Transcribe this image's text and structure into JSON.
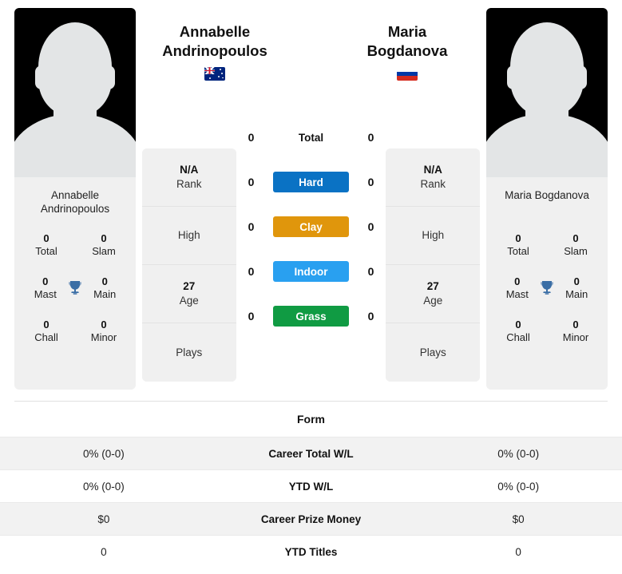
{
  "players": {
    "left": {
      "name_line1": "Annabelle",
      "name_line2": "Andrinopoulos",
      "full_name": "Annabelle Andrinopoulos",
      "flag": "au-flag-icon",
      "card_name_line1": "Annabelle",
      "card_name_line2": "Andrinopoulos",
      "titles": {
        "total_value": "0",
        "total_label": "Total",
        "slam_value": "0",
        "slam_label": "Slam",
        "mast_value": "0",
        "mast_label": "Mast",
        "main_value": "0",
        "main_label": "Main",
        "chall_value": "0",
        "chall_label": "Chall",
        "minor_value": "0",
        "minor_label": "Minor"
      },
      "info": {
        "rank_value": "N/A",
        "rank_label": "Rank",
        "high_value": "",
        "high_label": "High",
        "age_value": "27",
        "age_label": "Age",
        "plays_value": "",
        "plays_label": "Plays"
      },
      "surface_counts": {
        "total": "0",
        "hard": "0",
        "clay": "0",
        "indoor": "0",
        "grass": "0"
      },
      "form": {
        "career_wl": "0% (0-0)",
        "ytd_wl": "0% (0-0)",
        "career_prize_money": "$0",
        "ytd_titles": "0"
      }
    },
    "right": {
      "name_line1": "Maria",
      "name_line2": "Bogdanova",
      "full_name": "Maria Bogdanova",
      "flag": "ru-flag-icon",
      "card_name_line1": "Maria Bogdanova",
      "card_name_line2": "",
      "titles": {
        "total_value": "0",
        "total_label": "Total",
        "slam_value": "0",
        "slam_label": "Slam",
        "mast_value": "0",
        "mast_label": "Mast",
        "main_value": "0",
        "main_label": "Main",
        "chall_value": "0",
        "chall_label": "Chall",
        "minor_value": "0",
        "minor_label": "Minor"
      },
      "info": {
        "rank_value": "N/A",
        "rank_label": "Rank",
        "high_value": "",
        "high_label": "High",
        "age_value": "27",
        "age_label": "Age",
        "plays_value": "",
        "plays_label": "Plays"
      },
      "surface_counts": {
        "total": "0",
        "hard": "0",
        "clay": "0",
        "indoor": "0",
        "grass": "0"
      },
      "form": {
        "career_wl": "0% (0-0)",
        "ytd_wl": "0% (0-0)",
        "career_prize_money": "$0",
        "ytd_titles": "0"
      }
    }
  },
  "surfaces": [
    {
      "key": "total",
      "label": "Total",
      "color": "transparent",
      "text_color": "#111111"
    },
    {
      "key": "hard",
      "label": "Hard",
      "color": "#0a72c4",
      "text_color": "#ffffff"
    },
    {
      "key": "clay",
      "label": "Clay",
      "color": "#e0960c",
      "text_color": "#ffffff"
    },
    {
      "key": "indoor",
      "label": "Indoor",
      "color": "#29a0f0",
      "text_color": "#ffffff"
    },
    {
      "key": "grass",
      "label": "Grass",
      "color": "#109b43",
      "text_color": "#ffffff"
    }
  ],
  "form_section": {
    "header": "Form",
    "rows": [
      {
        "label": "Career Total W/L",
        "left": "0% (0-0)",
        "right": "0% (0-0)"
      },
      {
        "label": "YTD W/L",
        "left": "0% (0-0)",
        "right": "0% (0-0)"
      },
      {
        "label": "Career Prize Money",
        "left": "$0",
        "right": "$0"
      },
      {
        "label": "YTD Titles",
        "left": "0",
        "right": "0"
      }
    ]
  },
  "colors": {
    "card_bg": "#f0f0f0",
    "page_bg": "#ffffff",
    "row_alt_bg": "#f2f2f2",
    "trophy": "#3a6ea5",
    "hard": "#0a72c4",
    "clay": "#e0960c",
    "indoor": "#29a0f0",
    "grass": "#109b43"
  }
}
